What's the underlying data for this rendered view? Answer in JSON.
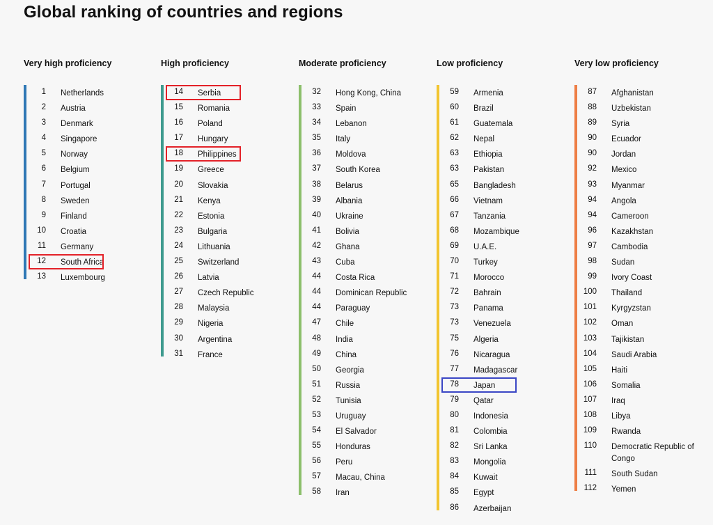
{
  "title": "Global ranking of countries and regions",
  "columns": [
    {
      "heading": "Very high proficiency",
      "color": "#2f78b5",
      "items": [
        {
          "rank": "1",
          "country": "Netherlands"
        },
        {
          "rank": "2",
          "country": "Austria"
        },
        {
          "rank": "3",
          "country": "Denmark"
        },
        {
          "rank": "4",
          "country": "Singapore"
        },
        {
          "rank": "5",
          "country": "Norway"
        },
        {
          "rank": "6",
          "country": "Belgium"
        },
        {
          "rank": "7",
          "country": "Portugal"
        },
        {
          "rank": "8",
          "country": "Sweden"
        },
        {
          "rank": "9",
          "country": "Finland"
        },
        {
          "rank": "10",
          "country": "Croatia"
        },
        {
          "rank": "11",
          "country": "Germany"
        },
        {
          "rank": "12",
          "country": "South Africa",
          "highlight": "red"
        },
        {
          "rank": "13",
          "country": "Luxembourg"
        }
      ]
    },
    {
      "heading": "High proficiency",
      "color": "#3e9a8e",
      "items": [
        {
          "rank": "14",
          "country": "Serbia",
          "highlight": "red"
        },
        {
          "rank": "15",
          "country": "Romania"
        },
        {
          "rank": "16",
          "country": "Poland"
        },
        {
          "rank": "17",
          "country": "Hungary"
        },
        {
          "rank": "18",
          "country": "Philippines",
          "highlight": "red"
        },
        {
          "rank": "19",
          "country": "Greece"
        },
        {
          "rank": "20",
          "country": "Slovakia"
        },
        {
          "rank": "21",
          "country": "Kenya"
        },
        {
          "rank": "22",
          "country": "Estonia"
        },
        {
          "rank": "23",
          "country": "Bulgaria"
        },
        {
          "rank": "24",
          "country": "Lithuania"
        },
        {
          "rank": "25",
          "country": "Switzerland"
        },
        {
          "rank": "26",
          "country": "Latvia"
        },
        {
          "rank": "27",
          "country": "Czech Republic"
        },
        {
          "rank": "28",
          "country": "Malaysia"
        },
        {
          "rank": "29",
          "country": "Nigeria"
        },
        {
          "rank": "30",
          "country": "Argentina"
        },
        {
          "rank": "31",
          "country": "France"
        }
      ]
    },
    {
      "heading": "Moderate proficiency",
      "color": "#8cbf6b",
      "items": [
        {
          "rank": "32",
          "country": "Hong Kong, China"
        },
        {
          "rank": "33",
          "country": "Spain"
        },
        {
          "rank": "34",
          "country": "Lebanon"
        },
        {
          "rank": "35",
          "country": "Italy"
        },
        {
          "rank": "36",
          "country": "Moldova"
        },
        {
          "rank": "37",
          "country": "South Korea"
        },
        {
          "rank": "38",
          "country": "Belarus"
        },
        {
          "rank": "39",
          "country": "Albania"
        },
        {
          "rank": "40",
          "country": "Ukraine"
        },
        {
          "rank": "41",
          "country": "Bolivia"
        },
        {
          "rank": "42",
          "country": "Ghana"
        },
        {
          "rank": "43",
          "country": "Cuba"
        },
        {
          "rank": "44",
          "country": "Costa Rica"
        },
        {
          "rank": "44",
          "country": "Dominican Republic"
        },
        {
          "rank": "44",
          "country": "Paraguay"
        },
        {
          "rank": "47",
          "country": "Chile"
        },
        {
          "rank": "48",
          "country": "India"
        },
        {
          "rank": "49",
          "country": "China"
        },
        {
          "rank": "50",
          "country": "Georgia"
        },
        {
          "rank": "51",
          "country": "Russia"
        },
        {
          "rank": "52",
          "country": "Tunisia"
        },
        {
          "rank": "53",
          "country": "Uruguay"
        },
        {
          "rank": "54",
          "country": "El Salvador"
        },
        {
          "rank": "55",
          "country": "Honduras"
        },
        {
          "rank": "56",
          "country": "Peru"
        },
        {
          "rank": "57",
          "country": "Macau, China"
        },
        {
          "rank": "58",
          "country": "Iran"
        }
      ]
    },
    {
      "heading": "Low proficiency",
      "color": "#f2c530",
      "items": [
        {
          "rank": "59",
          "country": "Armenia"
        },
        {
          "rank": "60",
          "country": "Brazil"
        },
        {
          "rank": "61",
          "country": "Guatemala"
        },
        {
          "rank": "62",
          "country": "Nepal"
        },
        {
          "rank": "63",
          "country": "Ethiopia"
        },
        {
          "rank": "63",
          "country": "Pakistan"
        },
        {
          "rank": "65",
          "country": "Bangladesh"
        },
        {
          "rank": "66",
          "country": "Vietnam"
        },
        {
          "rank": "67",
          "country": "Tanzania"
        },
        {
          "rank": "68",
          "country": "Mozambique"
        },
        {
          "rank": "69",
          "country": "U.A.E."
        },
        {
          "rank": "70",
          "country": "Turkey"
        },
        {
          "rank": "71",
          "country": "Morocco"
        },
        {
          "rank": "72",
          "country": "Bahrain"
        },
        {
          "rank": "73",
          "country": "Panama"
        },
        {
          "rank": "73",
          "country": "Venezuela"
        },
        {
          "rank": "75",
          "country": "Algeria"
        },
        {
          "rank": "76",
          "country": "Nicaragua"
        },
        {
          "rank": "77",
          "country": "Madagascar"
        },
        {
          "rank": "78",
          "country": "Japan",
          "highlight": "blue"
        },
        {
          "rank": "79",
          "country": "Qatar"
        },
        {
          "rank": "80",
          "country": "Indonesia"
        },
        {
          "rank": "81",
          "country": "Colombia"
        },
        {
          "rank": "82",
          "country": "Sri Lanka"
        },
        {
          "rank": "83",
          "country": "Mongolia"
        },
        {
          "rank": "84",
          "country": "Kuwait"
        },
        {
          "rank": "85",
          "country": "Egypt"
        },
        {
          "rank": "86",
          "country": "Azerbaijan"
        }
      ]
    },
    {
      "heading": "Very low proficiency",
      "color": "#ee7e45",
      "items": [
        {
          "rank": "87",
          "country": "Afghanistan"
        },
        {
          "rank": "88",
          "country": "Uzbekistan"
        },
        {
          "rank": "89",
          "country": "Syria"
        },
        {
          "rank": "90",
          "country": "Ecuador"
        },
        {
          "rank": "90",
          "country": "Jordan"
        },
        {
          "rank": "92",
          "country": "Mexico"
        },
        {
          "rank": "93",
          "country": "Myanmar"
        },
        {
          "rank": "94",
          "country": "Angola"
        },
        {
          "rank": "94",
          "country": "Cameroon"
        },
        {
          "rank": "96",
          "country": "Kazakhstan"
        },
        {
          "rank": "97",
          "country": "Cambodia"
        },
        {
          "rank": "98",
          "country": "Sudan"
        },
        {
          "rank": "99",
          "country": "Ivory Coast"
        },
        {
          "rank": "100",
          "country": "Thailand"
        },
        {
          "rank": "101",
          "country": "Kyrgyzstan"
        },
        {
          "rank": "102",
          "country": "Oman"
        },
        {
          "rank": "103",
          "country": "Tajikistan"
        },
        {
          "rank": "104",
          "country": "Saudi Arabia"
        },
        {
          "rank": "105",
          "country": "Haiti"
        },
        {
          "rank": "106",
          "country": "Somalia"
        },
        {
          "rank": "107",
          "country": "Iraq"
        },
        {
          "rank": "108",
          "country": "Libya"
        },
        {
          "rank": "109",
          "country": "Rwanda"
        },
        {
          "rank": "110",
          "country": "Democratic Republic of Congo"
        },
        {
          "rank": "111",
          "country": "South Sudan"
        },
        {
          "rank": "112",
          "country": "Yemen"
        }
      ]
    }
  ]
}
